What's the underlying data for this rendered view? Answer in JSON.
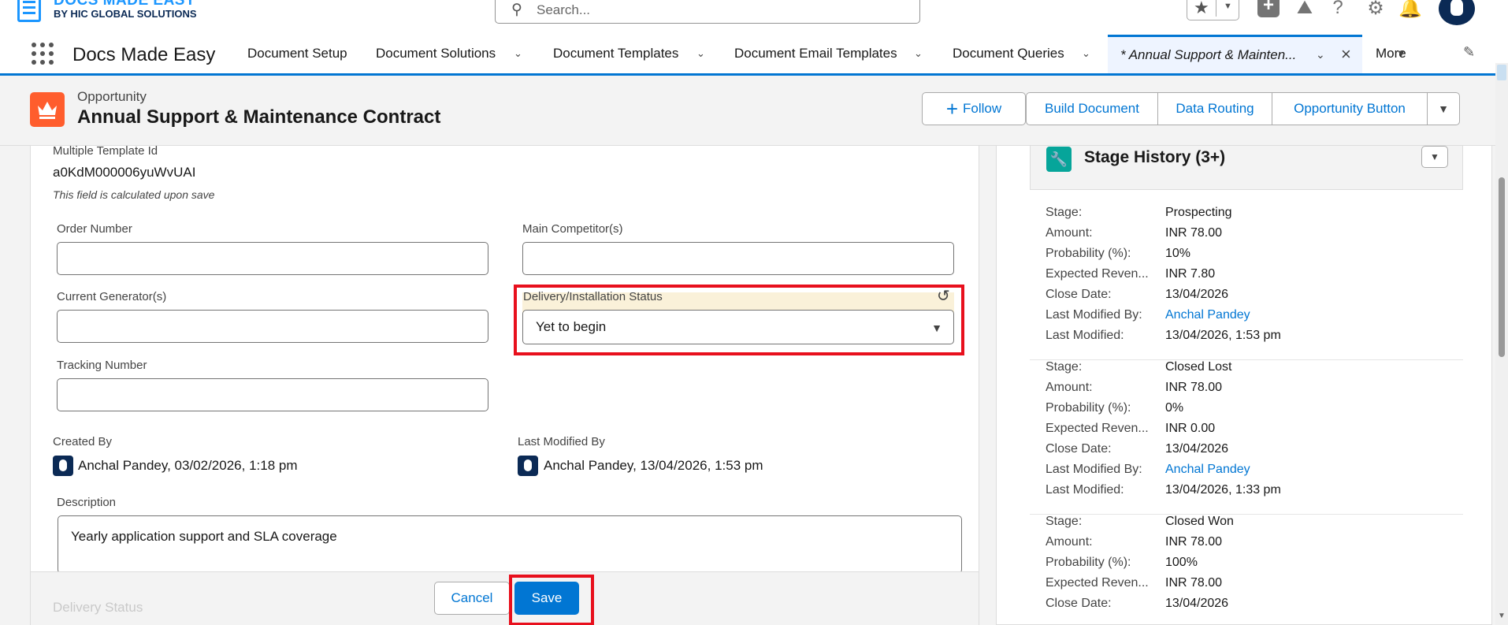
{
  "header": {
    "logo_line1": "DOCS MADE EASY",
    "logo_line2": "BY HIC GLOBAL SOLUTIONS",
    "search_placeholder": "Search..."
  },
  "nav": {
    "app_name": "Docs Made Easy",
    "items": [
      {
        "label": "Document Setup"
      },
      {
        "label": "Document Solutions"
      },
      {
        "label": "Document Templates"
      },
      {
        "label": "Document Email Templates"
      },
      {
        "label": "Document Queries"
      }
    ],
    "active_tab": "* Annual Support & Mainten...",
    "more_label": "More"
  },
  "record": {
    "object_type": "Opportunity",
    "title": "Annual Support & Maintenance Contract",
    "buttons": {
      "follow": "Follow",
      "build": "Build Document",
      "routing": "Data Routing",
      "opp": "Opportunity Button"
    }
  },
  "form": {
    "multiple_template_label": "Multiple Template Id",
    "multiple_template_value": "a0KdM000006yuWvUAI",
    "calc_note": "This field is calculated upon save",
    "order_number_label": "Order Number",
    "main_competitor_label": "Main Competitor(s)",
    "current_generator_label": "Current Generator(s)",
    "delivery_status_label": "Delivery/Installation Status",
    "delivery_status_value": "Yet to begin",
    "tracking_number_label": "Tracking Number",
    "created_by_label": "Created By",
    "created_by_value": "Anchal Pandey, 03/02/2026, 1:18 pm",
    "last_modified_label": "Last Modified By",
    "last_modified_value": "Anchal Pandey, 13/04/2026, 1:53 pm",
    "description_label": "Description",
    "description_value": "Yearly application support and SLA coverage",
    "ghost_label": "Delivery Status",
    "cancel_label": "Cancel",
    "save_label": "Save"
  },
  "stage_history": {
    "title": "Stage History (3+)",
    "keys": {
      "stage": "Stage:",
      "amount": "Amount:",
      "probability": "Probability (%):",
      "expected": "Expected Reven...",
      "close": "Close Date:",
      "modified_by": "Last Modified By:",
      "modified": "Last Modified:"
    },
    "entries": [
      {
        "stage": "Prospecting",
        "amount": "INR 78.00",
        "probability": "10%",
        "expected": "INR 7.80",
        "close": "13/04/2026",
        "modified_by": "Anchal Pandey",
        "modified": "13/04/2026, 1:53 pm"
      },
      {
        "stage": "Closed Lost",
        "amount": "INR 78.00",
        "probability": "0%",
        "expected": "INR 0.00",
        "close": "13/04/2026",
        "modified_by": "Anchal Pandey",
        "modified": "13/04/2026, 1:33 pm"
      },
      {
        "stage": "Closed Won",
        "amount": "INR 78.00",
        "probability": "100%",
        "expected": "INR 78.00",
        "close": "13/04/2026"
      }
    ]
  }
}
